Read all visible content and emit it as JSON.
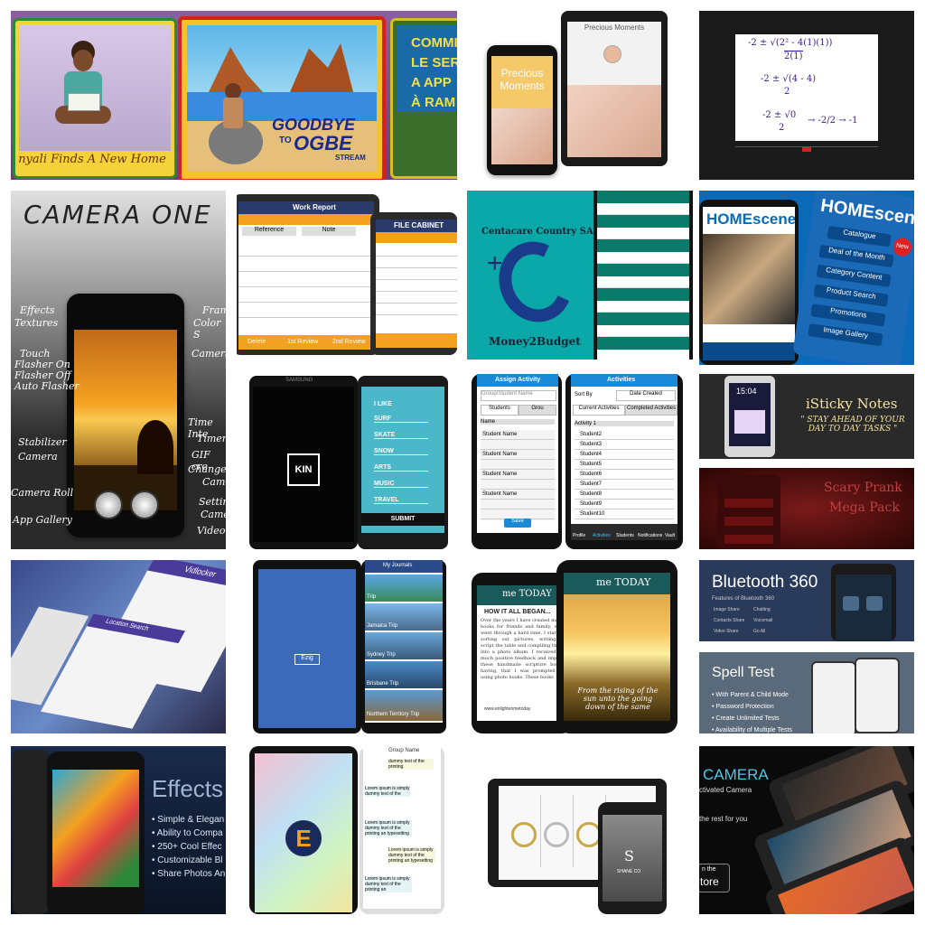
{
  "tiles": {
    "kids_book": {
      "card1_caption": "nyali Finds A New Home",
      "card2_title_1": "GOODBYE",
      "card2_title_2": "TO",
      "card2_title_3": "OGBE",
      "card2_title_4": "STREAM",
      "card3_lines": [
        "COMMI",
        "LE SERP",
        "A APP",
        "À RAM"
      ]
    },
    "precious": {
      "title": "Precious Moments",
      "tablet_title": "Precious Moments"
    },
    "math": {
      "line1": "-2 ± √(2² - 4(1)(1))",
      "line1_den": "2(1)",
      "line2": "-2 ± √(4 - 4)",
      "line2_den": "2",
      "line3": "-2 ± √0",
      "line3_den": "2",
      "line3_res": "→ -2/2 → -1"
    },
    "camera_one": {
      "title": "CAMERA ONE",
      "left_labels": [
        "Effects",
        "Textures",
        "Touch",
        "Flasher On",
        "Flasher Off",
        "Auto Flasher",
        "Stabilizer",
        "Camera",
        "Camera Roll",
        "App Gallery"
      ],
      "right_labels": [
        "Frame",
        "Color S",
        "Camera",
        "Time Inte",
        "Timer",
        "GIF cre",
        "Change",
        "Came",
        "Settin",
        "Came",
        "Video"
      ]
    },
    "work_report": {
      "title_left": "Work Report",
      "title_right": "FILE CABINET",
      "tab1": "Reference",
      "tab2": "Note",
      "footer": [
        "Delete",
        "1st Review",
        "2nd Review"
      ]
    },
    "money2budget": {
      "header": "Centacare Country SA",
      "footer": "Money2Budget"
    },
    "homescene": {
      "logo": "HOMEscene",
      "menu": [
        "Catalogue",
        "Deal of the Month",
        "Category Content",
        "Product Search",
        "Promotions",
        "Image Gallery"
      ],
      "badge": "New"
    },
    "kin": {
      "logo": "KIN",
      "brand": "SAMSUNG",
      "options": [
        "I LIKE",
        "SURF",
        "SKATE",
        "SNOW",
        "ARTS",
        "MUSIC",
        "TRAVEL"
      ],
      "submit": "SUBMIT"
    },
    "activity": {
      "left_title": "Assign Activity",
      "search_ph": "Group/Student Name",
      "left_tabs": [
        "Students",
        "Grou"
      ],
      "left_col": "Name",
      "student": "Student Name",
      "save": "Save",
      "right_title": "Activities",
      "sort_by": "Sort By",
      "date_created": "Date Created",
      "right_tabs": [
        "Current Activities",
        "Completed Activities"
      ],
      "activity": "Activity 1",
      "students": [
        "Student2",
        "Student3",
        "Student4",
        "Student5",
        "Student6",
        "Student7",
        "Student8",
        "Student9",
        "Student10"
      ],
      "nav": [
        "Profile",
        "Activities",
        "Students",
        "Notifications",
        "Vault"
      ]
    },
    "isticky": {
      "time": "15:04",
      "title": "iSticky Notes",
      "tagline": "\" STAY AHEAD OF YOUR DAY TO DAY TASKS \""
    },
    "scary": {
      "title_1": "Scary Prank",
      "title_2": "Mega Pack"
    },
    "bluetooth": {
      "title": "Bluetooth 360",
      "subtitle": "Features of Bluetooth 360",
      "features": [
        "Image Share",
        "Chatting",
        "Contacts Share",
        "Voicemail",
        "Video Share",
        "Go All"
      ]
    },
    "spelltest": {
      "title": "Spell Test",
      "bullets": [
        "• With Parent & Child Mode",
        "• Password Protection",
        "• Create Unlimited Tests",
        "• Availability of Multiple Tests"
      ]
    },
    "journals": {
      "header": "My Journals",
      "trips": [
        "Trip",
        "Jamaica Trip",
        "Sydney Trip",
        "Brisbane Trip",
        "Northern Territory Trip"
      ],
      "logo_text": "Ezig"
    },
    "metoday": {
      "logo": "me TODAY",
      "heading": "HOW IT ALL BEGAN...",
      "body": "Over the years I have created many books for friends and family, who went through a hard time. I started sorting out pictures, writing a script the table and compiling them into a photo album. I received so much positive feedback and impact these handmade scripture books having, that I was prompted to using photo books. These books",
      "website": "www.enlightenmetoday",
      "quote": "From the rising of the sun unto the going down of the same"
    },
    "effects": {
      "title": "Effects",
      "bullets": [
        "• Simple & Elegan",
        "• Ability to Compa",
        "• 250+ Cool Effec",
        "• Customizable Bl",
        "• Share Photos An"
      ]
    },
    "chat": {
      "group": "Group Name",
      "messages": [
        "dummy text of the printing",
        "Lorem ipsum is simply dummy text of the",
        "Lorem ipsum is simply dummy text of the printing an typesetting",
        "Lorem ipsum is simply dummy text of the printing an typesetting",
        "Lorem ipsum is simply dummy text of the printing an"
      ]
    },
    "rings": {
      "brand": "SHANE CO"
    },
    "camera_big": {
      "title": "CAMERA",
      "subtitle": "ctivated Camera",
      "tagline": "the rest for you",
      "store_1": "n the",
      "store_2": "tore"
    },
    "vidlocker": {
      "title": "Vidlocker",
      "subtitle": "Location Search"
    }
  }
}
